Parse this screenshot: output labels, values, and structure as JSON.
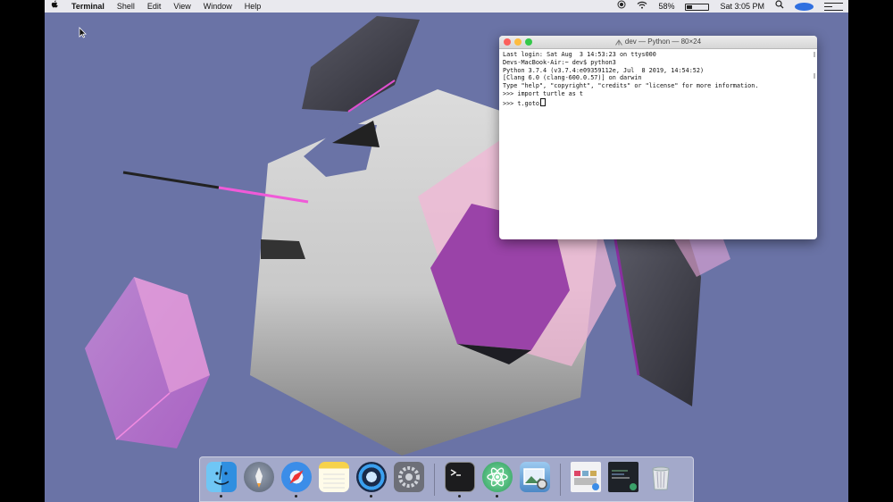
{
  "menubar": {
    "apple_icon": "apple-logo-icon",
    "app_name": "Terminal",
    "menus": [
      "Shell",
      "Edit",
      "View",
      "Window",
      "Help"
    ],
    "battery_percent": "58%",
    "clock": "Sat 3:05 PM",
    "status_icons": [
      "screen-record-icon",
      "wifi-icon",
      "battery-icon",
      "search-icon",
      "siri-icon",
      "notification-center-icon"
    ]
  },
  "terminal": {
    "title": "dev — Python — 80×24",
    "lines": [
      "Last login: Sat Aug  3 14:53:23 on ttys000",
      "Devs-MacBook-Air:~ dev$ python3",
      "Python 3.7.4 (v3.7.4:e09359112e, Jul  8 2019, 14:54:52)",
      "[Clang 6.0 (clang-600.0.57)] on darwin",
      "Type \"help\", \"copyright\", \"credits\" or \"license\" for more information.",
      ">>> import turtle as t",
      ">>> t.goto"
    ]
  },
  "dock": {
    "apps": [
      {
        "name": "Finder",
        "icon": "finder-icon",
        "running": true
      },
      {
        "name": "Launchpad",
        "icon": "launchpad-icon",
        "running": false
      },
      {
        "name": "Safari",
        "icon": "safari-icon",
        "running": true
      },
      {
        "name": "Notes",
        "icon": "notes-icon",
        "running": false
      },
      {
        "name": "QuickTime Player",
        "icon": "quicktime-icon",
        "running": true
      },
      {
        "name": "System Preferences",
        "icon": "system-preferences-icon",
        "running": false
      },
      {
        "name": "Terminal",
        "icon": "terminal-icon",
        "running": true
      },
      {
        "name": "Atom",
        "icon": "atom-icon",
        "running": true
      },
      {
        "name": "Preview",
        "icon": "preview-icon",
        "running": false
      },
      {
        "name": "Minimized window 1",
        "icon": "minimized-window-icon",
        "running": false
      },
      {
        "name": "Minimized window 2",
        "icon": "minimized-window-icon",
        "running": false
      },
      {
        "name": "Trash",
        "icon": "trash-icon",
        "running": false
      }
    ]
  },
  "colors": {
    "desktop": "#6a73a6",
    "accent_pink": "#e04fd0"
  }
}
